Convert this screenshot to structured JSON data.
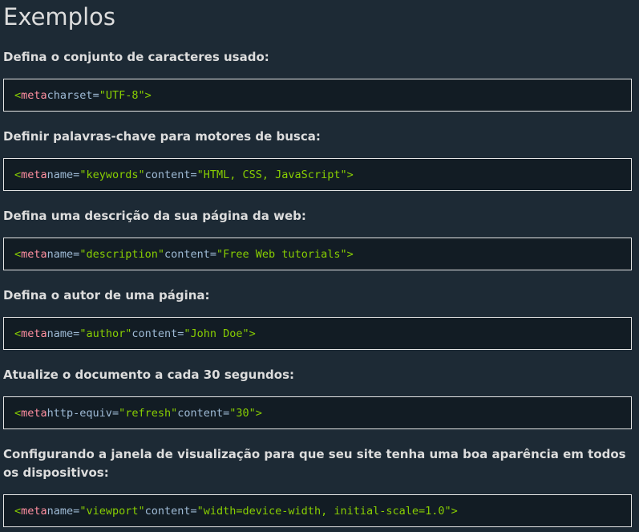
{
  "page_title": "Exemplos",
  "examples": [
    {
      "description": "Defina o conjunto de caracteres usado:",
      "code": {
        "tag": "meta",
        "attrs": [
          {
            "name": "charset",
            "value": "\"UTF-8\""
          }
        ]
      }
    },
    {
      "description": "Definir palavras-chave para motores de busca:",
      "code": {
        "tag": "meta",
        "attrs": [
          {
            "name": "name",
            "value": "\"keywords\""
          },
          {
            "name": "content",
            "value": "\"HTML, CSS, JavaScript\""
          }
        ]
      }
    },
    {
      "description": "Defina uma descrição da sua página da web:",
      "code": {
        "tag": "meta",
        "attrs": [
          {
            "name": "name",
            "value": "\"description\""
          },
          {
            "name": "content",
            "value": "\"Free Web tutorials\""
          }
        ]
      }
    },
    {
      "description": "Defina o autor de uma página:",
      "code": {
        "tag": "meta",
        "attrs": [
          {
            "name": "name",
            "value": "\"author\""
          },
          {
            "name": "content",
            "value": "\"John Doe\""
          }
        ]
      }
    },
    {
      "description": "Atualize o documento a cada 30 segundos:",
      "code": {
        "tag": "meta",
        "attrs": [
          {
            "name": "http-equiv",
            "value": "\"refresh\""
          },
          {
            "name": "content",
            "value": "\"30\""
          }
        ]
      }
    },
    {
      "description": "Configurando a janela de visualização para que seu site tenha uma boa aparência em todos os dispositivos:",
      "code": {
        "tag": "meta",
        "attrs": [
          {
            "name": "name",
            "value": "\"viewport\""
          },
          {
            "name": "content",
            "value": "\"width=device-width, initial-scale=1.0\""
          }
        ]
      }
    }
  ],
  "colors": {
    "background": "#1d2a35",
    "code_background": "#121c24",
    "tag": "#ff8fa0",
    "attribute": "#9fbbd6",
    "value": "#88ce02"
  }
}
